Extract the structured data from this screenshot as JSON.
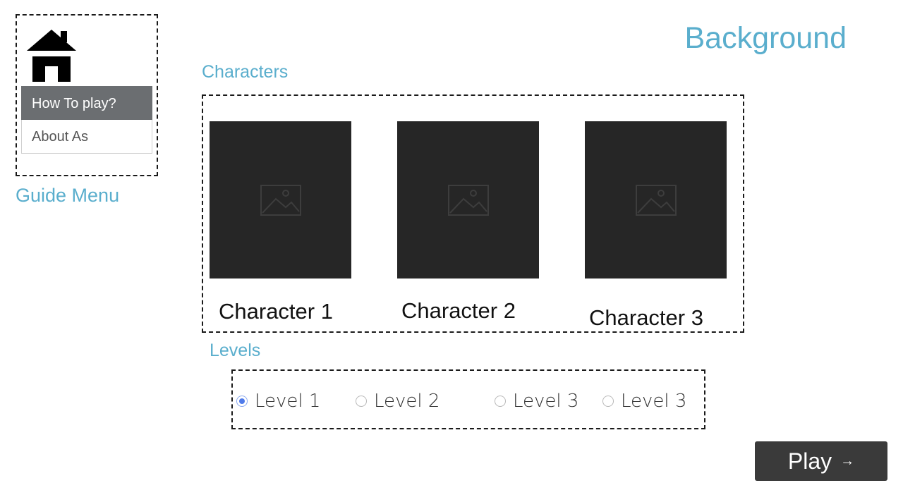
{
  "page": {
    "title": "Background"
  },
  "guide_menu": {
    "caption": "Guide Menu",
    "home_icon": "home-icon",
    "items": [
      {
        "label": "How To play?",
        "active": true
      },
      {
        "label": "About As",
        "active": false
      }
    ]
  },
  "characters": {
    "caption": "Characters",
    "items": [
      {
        "name": "Character 1",
        "icon": "image-placeholder-icon"
      },
      {
        "name": "Character 2",
        "icon": "image-placeholder-icon"
      },
      {
        "name": "Character 3",
        "icon": "image-placeholder-icon"
      }
    ]
  },
  "levels": {
    "caption": "Levels",
    "options": [
      {
        "label": "Level 1",
        "selected": true
      },
      {
        "label": "Level 2",
        "selected": false
      },
      {
        "label": "Level 3",
        "selected": false
      },
      {
        "label": "Level 3",
        "selected": false
      }
    ]
  },
  "play_button": {
    "label": "Play",
    "arrow": "→",
    "icon": "arrow-right-icon"
  },
  "colors": {
    "caption": "#5aaecd",
    "card": "#262626",
    "active_menu": "#6b6e71",
    "button": "#3a3a3a",
    "radio_selected": "#4f7bea"
  }
}
